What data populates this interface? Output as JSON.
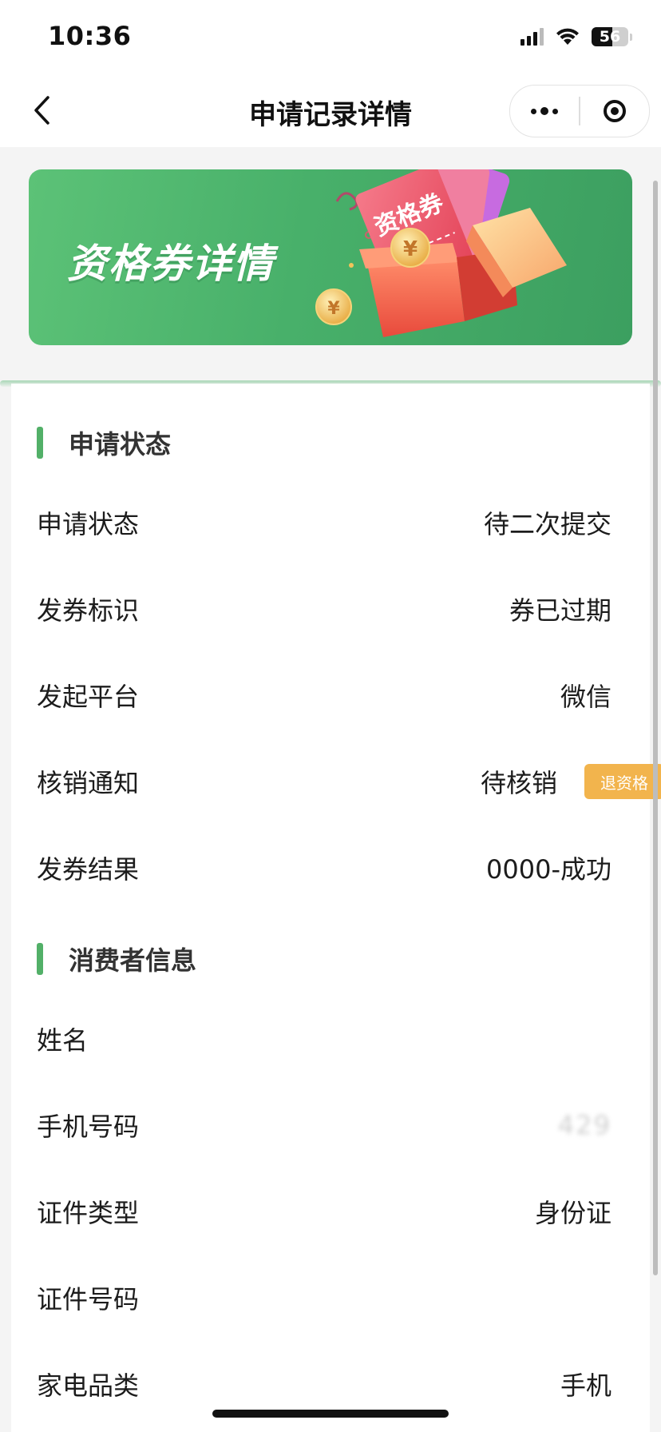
{
  "status_bar": {
    "time": "10:36",
    "battery": "56",
    "battery_level": 0.56,
    "icons": [
      "signal-icon",
      "wifi-icon",
      "battery-icon"
    ]
  },
  "nav": {
    "title": "申请记录详情",
    "icons": [
      "back-icon",
      "more-dots-icon",
      "target-icon"
    ]
  },
  "banner": {
    "title": "资格券详情",
    "coupon_text": "资格券",
    "coin_symbol": "¥"
  },
  "sections": [
    {
      "title": "申请状态",
      "rows": [
        {
          "label": "申请状态",
          "value": "待二次提交"
        },
        {
          "label": "发券标识",
          "value": "券已过期"
        },
        {
          "label": "发起平台",
          "value": "微信"
        },
        {
          "label": "核销通知",
          "value": "待核销",
          "action": "退资格"
        },
        {
          "label": "发券结果",
          "value": "0000-成功"
        }
      ]
    },
    {
      "title": "消费者信息",
      "rows": [
        {
          "label": "姓名",
          "value": ""
        },
        {
          "label": "手机号码",
          "value": "429"
        },
        {
          "label": "证件类型",
          "value": "身份证"
        },
        {
          "label": "证件号码",
          "value": ""
        },
        {
          "label": "家电品类",
          "value": "手机"
        }
      ]
    }
  ],
  "colors": {
    "accent_green": "#52b068",
    "banner_green": "#4db36c",
    "action_orange": "#f2b44d"
  }
}
